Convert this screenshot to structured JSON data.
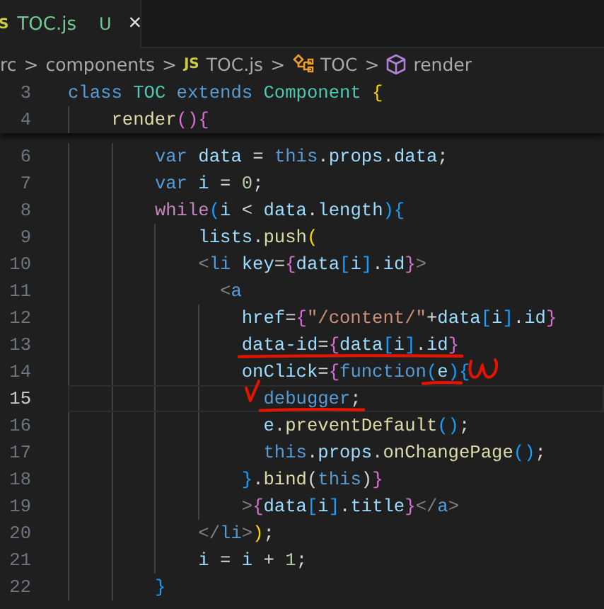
{
  "tab": {
    "icon_text": "S",
    "title": "TOC.js",
    "status": "U",
    "close": "×",
    "selected": true
  },
  "breadcrumb": [
    {
      "kind": "folder",
      "label": "rc"
    },
    {
      "kind": "folder",
      "label": "components"
    },
    {
      "kind": "file",
      "icon_text": "JS",
      "label": "TOC.js"
    },
    {
      "kind": "class",
      "label": "TOC"
    },
    {
      "kind": "method",
      "label": "render"
    }
  ],
  "breadcrumb_separator": ">",
  "sticky_lines": [
    {
      "number": "3",
      "tokens": [
        {
          "t": "class",
          "kind": "kw"
        },
        {
          "t": " TOC",
          "kind": "type"
        },
        {
          "t": " extends",
          "kind": "kw"
        },
        {
          "t": " Component",
          "kind": "type"
        },
        {
          "t": " {",
          "kind": "b1"
        }
      ]
    },
    {
      "number": "4",
      "tokens": [
        {
          "t": "    render",
          "kind": "fn"
        },
        {
          "t": "(){",
          "kind": "b2"
        }
      ]
    }
  ],
  "lines": [
    {
      "number": "6",
      "current": false,
      "tokens": [
        {
          "t": "        var",
          "kind": "kw"
        },
        {
          "t": " data",
          "kind": "var"
        },
        {
          "t": " = ",
          "kind": "op"
        },
        {
          "t": "this",
          "kind": "kw"
        },
        {
          "t": ".",
          "kind": "op"
        },
        {
          "t": "props",
          "kind": "var"
        },
        {
          "t": ".",
          "kind": "op"
        },
        {
          "t": "data",
          "kind": "var"
        },
        {
          "t": ";",
          "kind": "op"
        }
      ]
    },
    {
      "number": "7",
      "current": false,
      "tokens": [
        {
          "t": "        var",
          "kind": "kw"
        },
        {
          "t": " i",
          "kind": "var"
        },
        {
          "t": " = ",
          "kind": "op"
        },
        {
          "t": "0",
          "kind": "num"
        },
        {
          "t": ";",
          "kind": "op"
        }
      ]
    },
    {
      "number": "8",
      "current": false,
      "tokens": [
        {
          "t": "        while",
          "kind": "ctrl"
        },
        {
          "t": "(",
          "kind": "b3"
        },
        {
          "t": "i",
          "kind": "var"
        },
        {
          "t": " < ",
          "kind": "op"
        },
        {
          "t": "data",
          "kind": "var"
        },
        {
          "t": ".",
          "kind": "op"
        },
        {
          "t": "length",
          "kind": "var"
        },
        {
          "t": "){",
          "kind": "b3"
        }
      ]
    },
    {
      "number": "9",
      "current": false,
      "tokens": [
        {
          "t": "            lists",
          "kind": "var"
        },
        {
          "t": ".",
          "kind": "op"
        },
        {
          "t": "push",
          "kind": "fn"
        },
        {
          "t": "(",
          "kind": "b1"
        }
      ]
    },
    {
      "number": "10",
      "current": false,
      "tokens": [
        {
          "t": "            <",
          "kind": "tag"
        },
        {
          "t": "li",
          "kind": "tagname"
        },
        {
          "t": " key",
          "kind": "var"
        },
        {
          "t": "=",
          "kind": "op"
        },
        {
          "t": "{",
          "kind": "b2"
        },
        {
          "t": "data",
          "kind": "var"
        },
        {
          "t": "[",
          "kind": "b3"
        },
        {
          "t": "i",
          "kind": "var"
        },
        {
          "t": "]",
          "kind": "b3"
        },
        {
          "t": ".",
          "kind": "op"
        },
        {
          "t": "id",
          "kind": "var"
        },
        {
          "t": "}",
          "kind": "b2"
        },
        {
          "t": ">",
          "kind": "tag"
        }
      ]
    },
    {
      "number": "11",
      "current": false,
      "tokens": [
        {
          "t": "              <",
          "kind": "tag"
        },
        {
          "t": "a",
          "kind": "tagname"
        }
      ]
    },
    {
      "number": "12",
      "current": false,
      "tokens": [
        {
          "t": "                href",
          "kind": "var"
        },
        {
          "t": "=",
          "kind": "op"
        },
        {
          "t": "{",
          "kind": "b2"
        },
        {
          "t": "\"/content/\"",
          "kind": "str"
        },
        {
          "t": "+",
          "kind": "op"
        },
        {
          "t": "data",
          "kind": "var"
        },
        {
          "t": "[",
          "kind": "b3"
        },
        {
          "t": "i",
          "kind": "var"
        },
        {
          "t": "]",
          "kind": "b3"
        },
        {
          "t": ".",
          "kind": "op"
        },
        {
          "t": "id",
          "kind": "var"
        },
        {
          "t": "}",
          "kind": "b2"
        }
      ]
    },
    {
      "number": "13",
      "current": false,
      "tokens": [
        {
          "kind": "group",
          "underlined": true,
          "tokens": [
            {
              "t": "                data-id",
              "kind": "var"
            },
            {
              "t": "=",
              "kind": "op"
            },
            {
              "t": "{",
              "kind": "b2"
            },
            {
              "t": "data",
              "kind": "var"
            },
            {
              "t": "[",
              "kind": "b3"
            },
            {
              "t": "i",
              "kind": "var"
            },
            {
              "t": "]",
              "kind": "b3"
            },
            {
              "t": ".",
              "kind": "op"
            },
            {
              "t": "id",
              "kind": "var"
            },
            {
              "t": "}",
              "kind": "b2"
            }
          ]
        }
      ]
    },
    {
      "number": "14",
      "current": false,
      "tokens": [
        {
          "t": "                onClick",
          "kind": "var"
        },
        {
          "t": "=",
          "kind": "op"
        },
        {
          "t": "{",
          "kind": "b2"
        },
        {
          "t": "function",
          "kind": "kw"
        },
        {
          "kind": "group",
          "underlined": true,
          "tokens": [
            {
              "t": "(",
              "kind": "b3"
            },
            {
              "t": "e",
              "kind": "var"
            },
            {
              "t": ")",
              "kind": "b3"
            }
          ]
        },
        {
          "t": "{",
          "kind": "b3",
          "squiggled": true
        }
      ]
    },
    {
      "number": "15",
      "current": true,
      "tokens": [
        {
          "kind": "group",
          "underlined": true,
          "ticked": true,
          "tokens": [
            {
              "t": "                  debugger",
              "kind": "kw"
            },
            {
              "t": ";",
              "kind": "op"
            }
          ]
        }
      ]
    },
    {
      "number": "16",
      "current": false,
      "tokens": [
        {
          "t": "                  e",
          "kind": "var"
        },
        {
          "t": ".",
          "kind": "op"
        },
        {
          "t": "preventDefault",
          "kind": "fn"
        },
        {
          "t": "()",
          "kind": "b3"
        },
        {
          "t": ";",
          "kind": "op"
        }
      ]
    },
    {
      "number": "17",
      "current": false,
      "tokens": [
        {
          "t": "                  this",
          "kind": "kw"
        },
        {
          "t": ".",
          "kind": "op"
        },
        {
          "t": "props",
          "kind": "var"
        },
        {
          "t": ".",
          "kind": "op"
        },
        {
          "t": "onChangePage",
          "kind": "fn"
        },
        {
          "t": "()",
          "kind": "b3"
        },
        {
          "t": ";",
          "kind": "op"
        }
      ]
    },
    {
      "number": "18",
      "current": false,
      "tokens": [
        {
          "t": "                }",
          "kind": "b3"
        },
        {
          "t": ".",
          "kind": "op"
        },
        {
          "t": "bind",
          "kind": "fn"
        },
        {
          "t": "(",
          "kind": "op"
        },
        {
          "t": "this",
          "kind": "kw"
        },
        {
          "t": ")",
          "kind": "op"
        },
        {
          "t": "}",
          "kind": "b2"
        }
      ]
    },
    {
      "number": "19",
      "current": false,
      "tokens": [
        {
          "t": "                >",
          "kind": "tag"
        },
        {
          "t": "{",
          "kind": "b2"
        },
        {
          "t": "data",
          "kind": "var"
        },
        {
          "t": "[",
          "kind": "b3"
        },
        {
          "t": "i",
          "kind": "var"
        },
        {
          "t": "]",
          "kind": "b3"
        },
        {
          "t": ".",
          "kind": "op"
        },
        {
          "t": "title",
          "kind": "var"
        },
        {
          "t": "}",
          "kind": "b2"
        },
        {
          "t": "</",
          "kind": "tag"
        },
        {
          "t": "a",
          "kind": "tagname"
        },
        {
          "t": ">",
          "kind": "tag"
        }
      ]
    },
    {
      "number": "20",
      "current": false,
      "tokens": [
        {
          "t": "            </",
          "kind": "tag"
        },
        {
          "t": "li",
          "kind": "tagname"
        },
        {
          "t": ">",
          "kind": "tag"
        },
        {
          "t": ")",
          "kind": "b1"
        },
        {
          "t": ";",
          "kind": "op"
        }
      ]
    },
    {
      "number": "21",
      "current": false,
      "tokens": [
        {
          "t": "            i",
          "kind": "var"
        },
        {
          "t": " = ",
          "kind": "op"
        },
        {
          "t": "i",
          "kind": "var"
        },
        {
          "t": " + ",
          "kind": "op"
        },
        {
          "t": "1",
          "kind": "num"
        },
        {
          "t": ";",
          "kind": "op"
        }
      ]
    },
    {
      "number": "22",
      "current": false,
      "tokens": [
        {
          "t": "        }",
          "kind": "b3"
        }
      ]
    }
  ]
}
